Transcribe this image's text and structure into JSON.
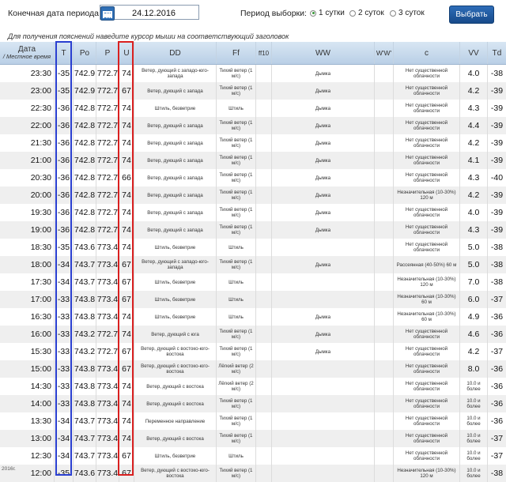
{
  "controls": {
    "end_date_label": "Конечная дата периода:",
    "end_date_value": "24.12.2016",
    "period_label": "Период выборки:",
    "radio_options": [
      {
        "label": "1 сутки",
        "selected": true
      },
      {
        "label": "2 суток",
        "selected": false
      },
      {
        "label": "3 суток",
        "selected": false
      }
    ],
    "select_button": "Выбрать"
  },
  "hint": "Для получения пояснений наведите курсор мыши на соответствующий заголовок",
  "table": {
    "headers": {
      "date": "Дата",
      "local_time": "/ Местное время",
      "T": "T",
      "Po": "Po",
      "P": "P",
      "U": "U",
      "DD": "DD",
      "Ff": "Ff",
      "ff10": "ff10",
      "WW": "WW",
      "W1W2": "W'W'",
      "c": "c",
      "VV": "VV",
      "Td": "Td"
    },
    "rows": [
      {
        "time": "23:30",
        "T": "-35",
        "Po": "742.9",
        "P": "772.7",
        "U": "74",
        "DD": "Ветер, дующий с западо-юго-запада",
        "Ff": "Тихий ветер (1 м/с)",
        "WW": "Дымка",
        "c": "Нет существенной облачности",
        "VV": "4.0",
        "Td": "-38"
      },
      {
        "time": "23:00",
        "T": "-35",
        "Po": "742.9",
        "P": "772.7",
        "U": "67",
        "DD": "Ветер, дующий с запада",
        "Ff": "Тихий ветер (1 м/с)",
        "WW": "Дымка",
        "c": "Нет существенной облачности",
        "VV": "4.2",
        "Td": "-39"
      },
      {
        "time": "22:30",
        "T": "-36",
        "Po": "742.8",
        "P": "772.7",
        "U": "74",
        "DD": "Штиль, безветрие",
        "Ff": "Штиль",
        "WW": "Дымка",
        "c": "Нет существенной облачности",
        "VV": "4.3",
        "Td": "-39"
      },
      {
        "time": "22:00",
        "T": "-36",
        "Po": "742.8",
        "P": "772.7",
        "U": "74",
        "DD": "Ветер, дующий с запада",
        "Ff": "Тихий ветер (1 м/с)",
        "WW": "Дымка",
        "c": "Нет существенной облачности",
        "VV": "4.4",
        "Td": "-39"
      },
      {
        "time": "21:30",
        "T": "-36",
        "Po": "742.8",
        "P": "772.7",
        "U": "74",
        "DD": "Ветер, дующий с запада",
        "Ff": "Тихий ветер (1 м/с)",
        "WW": "Дымка",
        "c": "Нет существенной облачности",
        "VV": "4.2",
        "Td": "-39"
      },
      {
        "time": "21:00",
        "T": "-36",
        "Po": "742.8",
        "P": "772.7",
        "U": "74",
        "DD": "Ветер, дующий с запада",
        "Ff": "Тихий ветер (1 м/с)",
        "WW": "Дымка",
        "c": "Нет существенной облачности",
        "VV": "4.1",
        "Td": "-39"
      },
      {
        "time": "20:30",
        "T": "-36",
        "Po": "742.8",
        "P": "772.7",
        "U": "66",
        "DD": "Ветер, дующий с запада",
        "Ff": "Тихий ветер (1 м/с)",
        "WW": "Дымка",
        "c": "Нет существенной облачности",
        "VV": "4.3",
        "Td": "-40"
      },
      {
        "time": "20:00",
        "T": "-36",
        "Po": "742.8",
        "P": "772.7",
        "U": "74",
        "DD": "Ветер, дующий с запада",
        "Ff": "Тихий ветер (1 м/с)",
        "WW": "Дымка",
        "c": "Незначительная (10-30%) 120 м",
        "VV": "4.2",
        "Td": "-39"
      },
      {
        "time": "19:30",
        "T": "-36",
        "Po": "742.8",
        "P": "772.7",
        "U": "74",
        "DD": "Ветер, дующий с запада",
        "Ff": "Тихий ветер (1 м/с)",
        "WW": "Дымка",
        "c": "Нет существенной облачности",
        "VV": "4.0",
        "Td": "-39"
      },
      {
        "time": "19:00",
        "T": "-36",
        "Po": "742.8",
        "P": "772.7",
        "U": "74",
        "DD": "Ветер, дующий с запада",
        "Ff": "Тихий ветер (1 м/с)",
        "WW": "Дымка",
        "c": "Нет существенной облачности",
        "VV": "4.3",
        "Td": "-39"
      },
      {
        "time": "18:30",
        "T": "-35",
        "Po": "743.6",
        "P": "773.4",
        "U": "74",
        "DD": "Штиль, безветрие",
        "Ff": "Штиль",
        "WW": "",
        "c": "Нет существенной облачности",
        "VV": "5.0",
        "Td": "-38"
      },
      {
        "time": "18:00",
        "T": "-34",
        "Po": "743.7",
        "P": "773.4",
        "U": "67",
        "DD": "Ветер, дующий с западо-юго-запада",
        "Ff": "Тихий ветер (1 м/с)",
        "WW": "Дымка",
        "c": "Рассеянная (40-50%) 60 м",
        "VV": "5.0",
        "Td": "-38"
      },
      {
        "time": "17:30",
        "T": "-34",
        "Po": "743.7",
        "P": "773.4",
        "U": "67",
        "DD": "Штиль, безветрие",
        "Ff": "Штиль",
        "WW": "",
        "c": "Незначительная (10-30%) 120 м",
        "VV": "7.0",
        "Td": "-38"
      },
      {
        "time": "17:00",
        "T": "-33",
        "Po": "743.8",
        "P": "773.4",
        "U": "67",
        "DD": "Штиль, безветрие",
        "Ff": "Штиль",
        "WW": "",
        "c": "Незначительная (10-30%) 60 м",
        "VV": "6.0",
        "Td": "-37"
      },
      {
        "time": "16:30",
        "T": "-33",
        "Po": "743.8",
        "P": "773.4",
        "U": "74",
        "DD": "Штиль, безветрие",
        "Ff": "Штиль",
        "WW": "Дымка",
        "c": "Незначительная (10-30%) 60 м",
        "VV": "4.9",
        "Td": "-36"
      },
      {
        "time": "16:00",
        "T": "-33",
        "Po": "743.2",
        "P": "772.7",
        "U": "74",
        "DD": "Ветер, дующий с юга",
        "Ff": "Тихий ветер (1 м/с)",
        "WW": "Дымка",
        "c": "Нет существенной облачности",
        "VV": "4.6",
        "Td": "-36"
      },
      {
        "time": "15:30",
        "T": "-33",
        "Po": "743.2",
        "P": "772.7",
        "U": "67",
        "DD": "Ветер, дующий с востоко-юго-востока",
        "Ff": "Тихий ветер (1 м/с)",
        "WW": "Дымка",
        "c": "Нет существенной облачности",
        "VV": "4.2",
        "Td": "-37"
      },
      {
        "time": "15:00",
        "T": "-33",
        "Po": "743.8",
        "P": "773.4",
        "U": "67",
        "DD": "Ветер, дующий с востоко-юго-востока",
        "Ff": "Лёгкий ветер (2 м/с)",
        "WW": "",
        "c": "Нет существенной облачности",
        "VV": "8.0",
        "Td": "-36"
      },
      {
        "time": "14:30",
        "T": "-33",
        "Po": "743.8",
        "P": "773.4",
        "U": "74",
        "DD": "Ветер, дующий с востока",
        "Ff": "Лёгкий ветер (2 м/с)",
        "WW": "",
        "c": "Нет существенной облачности",
        "VV": "10.0 и более",
        "Td": "-36"
      },
      {
        "time": "14:00",
        "T": "-33",
        "Po": "743.8",
        "P": "773.4",
        "U": "74",
        "DD": "Ветер, дующий с востока",
        "Ff": "Тихий ветер (1 м/с)",
        "WW": "",
        "c": "Нет существенной облачности",
        "VV": "10.0 и более",
        "Td": "-36"
      },
      {
        "time": "13:30",
        "T": "-34",
        "Po": "743.7",
        "P": "773.4",
        "U": "74",
        "DD": "Переменное направление",
        "Ff": "Тихий ветер (1 м/с)",
        "WW": "",
        "c": "Нет существенной облачности",
        "VV": "10.0 и более",
        "Td": "-36"
      },
      {
        "time": "13:00",
        "T": "-34",
        "Po": "743.7",
        "P": "773.4",
        "U": "74",
        "DD": "Ветер, дующий с востока",
        "Ff": "Тихий ветер (1 м/с)",
        "WW": "",
        "c": "Нет существенной облачности",
        "VV": "10.0 и более",
        "Td": "-37"
      },
      {
        "time": "12:30",
        "T": "-34",
        "Po": "743.7",
        "P": "773.4",
        "U": "67",
        "DD": "Штиль, безветрие",
        "Ff": "Штиль",
        "WW": "",
        "c": "Нет существенной облачности",
        "VV": "10.0 и более",
        "Td": "-37"
      },
      {
        "time": "12:00",
        "T": "-35",
        "Po": "743.6",
        "P": "773.4",
        "U": "67",
        "DD": "Ветер, дующий с востоко-юго-востока",
        "Ff": "Тихий ветер (1 м/с)",
        "WW": "",
        "c": "Незначительная (10-30%) 120 м",
        "VV": "10.0 и более",
        "Td": "-38"
      }
    ]
  },
  "corner_note": "2016г."
}
